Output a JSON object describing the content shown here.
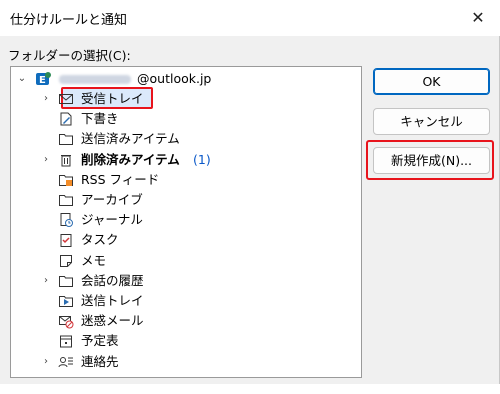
{
  "dialog": {
    "title": "仕分けルールと通知",
    "close_glyph": "✕",
    "folder_label": "フォルダーの選択(C):",
    "account_suffix": "@outlook.jp"
  },
  "tree": [
    {
      "label": "受信トレイ",
      "icon": "inbox-icon",
      "expander": true,
      "selected": true
    },
    {
      "label": "下書き",
      "icon": "drafts-icon",
      "expander": false
    },
    {
      "label": "送信済みアイテム",
      "icon": "sent-items-icon",
      "expander": false
    },
    {
      "label": "削除済みアイテム",
      "icon": "trash-icon",
      "expander": true,
      "bold": true,
      "count": "(1)"
    },
    {
      "label": "RSS フィード",
      "icon": "rss-icon",
      "expander": false
    },
    {
      "label": "アーカイブ",
      "icon": "archive-icon",
      "expander": false
    },
    {
      "label": "ジャーナル",
      "icon": "journal-icon",
      "expander": false
    },
    {
      "label": "タスク",
      "icon": "tasks-icon",
      "expander": false
    },
    {
      "label": "メモ",
      "icon": "notes-icon",
      "expander": false
    },
    {
      "label": "会話の履歴",
      "icon": "conversation-history-icon",
      "expander": true
    },
    {
      "label": "送信トレイ",
      "icon": "outbox-icon",
      "expander": false
    },
    {
      "label": "迷惑メール",
      "icon": "junk-email-icon",
      "expander": false
    },
    {
      "label": "予定表",
      "icon": "calendar-icon",
      "expander": false
    },
    {
      "label": "連絡先",
      "icon": "contacts-icon",
      "expander": true
    }
  ],
  "buttons": {
    "ok": "OK",
    "cancel": "キャンセル",
    "new": "新規作成(N)..."
  },
  "colors": {
    "highlight_red": "#e8141c",
    "outlook_blue": "#0f6cbd"
  }
}
